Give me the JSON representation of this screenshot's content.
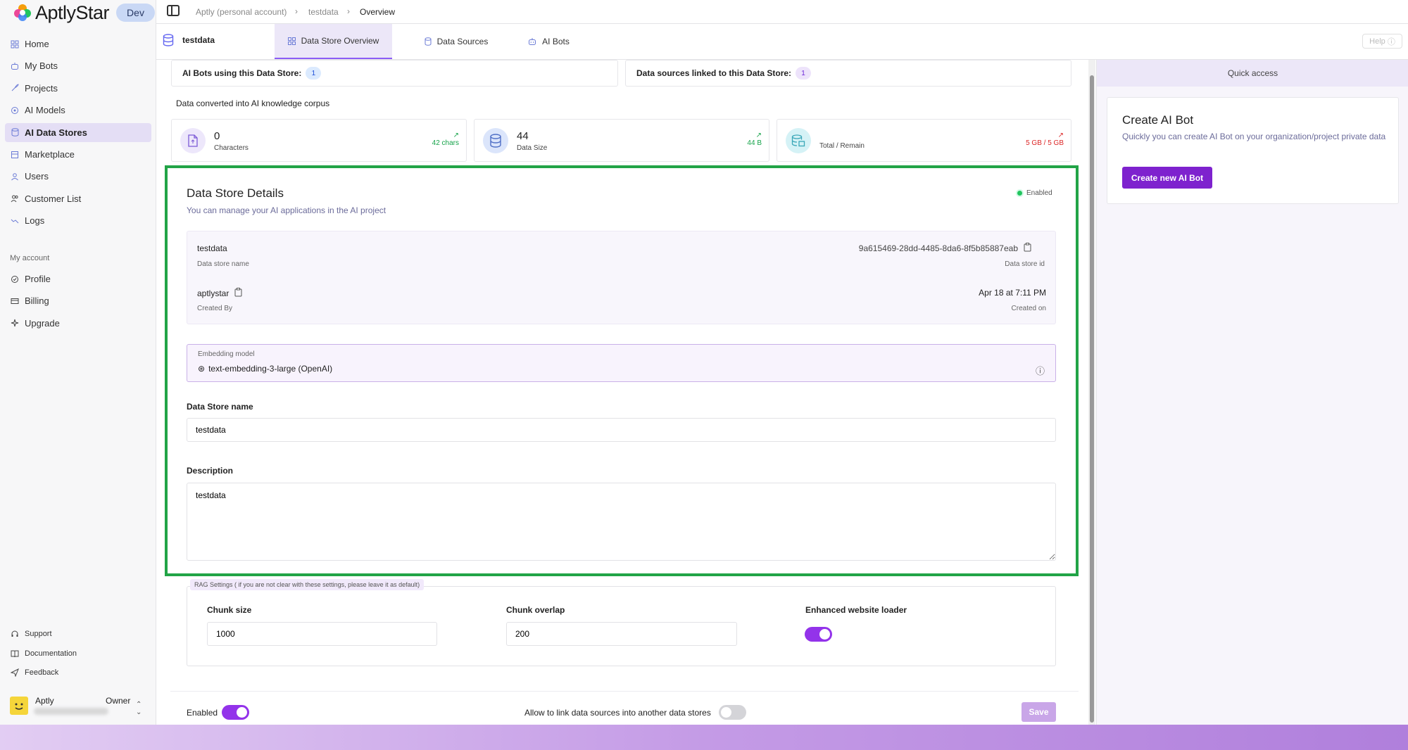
{
  "brand": {
    "name": "AptlyStar",
    "env_badge": "Dev"
  },
  "sidebar": {
    "items": [
      {
        "label": "Home",
        "icon": "grid-icon"
      },
      {
        "label": "My Bots",
        "icon": "bot-icon"
      },
      {
        "label": "Projects",
        "icon": "rocket-icon"
      },
      {
        "label": "AI Models",
        "icon": "model-icon"
      },
      {
        "label": "AI Data Stores",
        "icon": "database-icon",
        "active": true
      },
      {
        "label": "Marketplace",
        "icon": "store-icon"
      },
      {
        "label": "Users",
        "icon": "user-icon"
      },
      {
        "label": "Customer List",
        "icon": "users-icon"
      },
      {
        "label": "Logs",
        "icon": "trend-icon"
      }
    ],
    "account_label": "My account",
    "account_items": [
      {
        "label": "Profile",
        "icon": "profile-icon"
      },
      {
        "label": "Billing",
        "icon": "card-icon"
      },
      {
        "label": "Upgrade",
        "icon": "sparkle-icon"
      }
    ],
    "footer_items": [
      {
        "label": "Support",
        "icon": "headset-icon"
      },
      {
        "label": "Documentation",
        "icon": "book-icon"
      },
      {
        "label": "Feedback",
        "icon": "send-icon"
      }
    ],
    "user": {
      "name": "Aptly",
      "role": "Owner"
    }
  },
  "breadcrumb": [
    "Aptly (personal account)",
    "testdata",
    "Overview"
  ],
  "tabbar": {
    "store_name": "testdata",
    "tabs": [
      {
        "label": "Data Store Overview",
        "active": true
      },
      {
        "label": "Data Sources"
      },
      {
        "label": "AI Bots"
      }
    ],
    "help": "Help"
  },
  "summary": {
    "bots_label": "AI Bots using this Data Store:",
    "bots_count": "1",
    "sources_label": "Data sources linked to this Data Store:",
    "sources_count": "1",
    "corpus_label": "Data converted into AI knowledge corpus"
  },
  "stats": [
    {
      "value": "0",
      "label": "Characters",
      "trend": "42 chars",
      "trend_color": "#16a34a"
    },
    {
      "value": "44",
      "label": "Data Size",
      "trend": "44 B",
      "trend_color": "#16a34a"
    },
    {
      "value": "",
      "label": "Total / Remain",
      "trend": "5 GB / 5 GB",
      "trend_color": "#dc2626"
    }
  ],
  "details": {
    "title": "Data Store Details",
    "subtitle": "You can manage your AI applications in the AI project",
    "status": "Enabled",
    "name_value": "testdata",
    "name_caption": "Data store name",
    "id_value": "9a615469-28dd-4485-8da6-8f5b85887eab",
    "id_caption": "Data store id",
    "creator_value": "aptlystar",
    "creator_caption": "Created By",
    "created_value": "Apr 18 at 7:11 PM",
    "created_caption": "Created on",
    "embedding_label": "Embedding model",
    "embedding_value": "text-embedding-3-large (OpenAI)",
    "name_field_label": "Data Store name",
    "name_field_value": "testdata",
    "desc_label": "Description",
    "desc_value": "testdata"
  },
  "rag": {
    "legend": "RAG Settings ( if you are not clear with these settings, please leave it as default)",
    "chunk_size_label": "Chunk size",
    "chunk_size_value": "1000",
    "chunk_overlap_label": "Chunk overlap",
    "chunk_overlap_value": "200",
    "loader_label": "Enhanced website loader",
    "loader_on": true
  },
  "footer_controls": {
    "enabled_label": "Enabled",
    "enabled_on": true,
    "link_label": "Allow to link data sources into another data stores",
    "link_on": false,
    "save_label": "Save"
  },
  "quick_access": {
    "title": "Quick access",
    "card_title": "Create AI Bot",
    "card_desc": "Quickly you can create AI Bot on your organization/project private data",
    "card_button": "Create new AI Bot"
  },
  "colors": {
    "accent": "#7e22ce",
    "highlight_box": "#22a447",
    "active_nav": "#e4def5"
  }
}
